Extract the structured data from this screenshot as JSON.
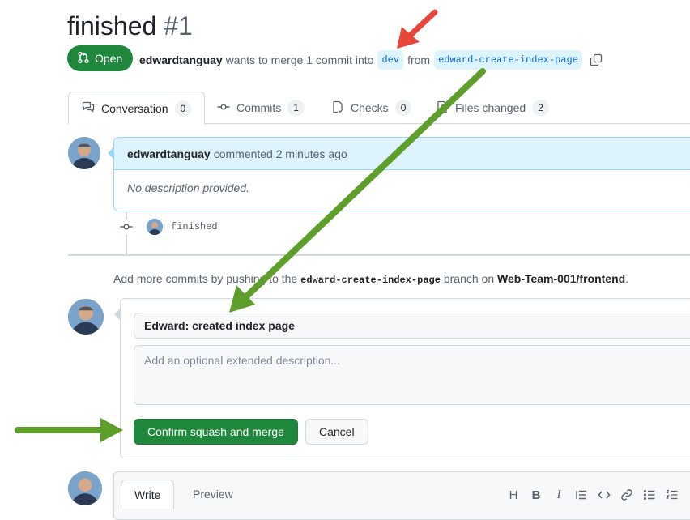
{
  "pr": {
    "title": "finished",
    "number": "#1",
    "status": "Open",
    "author": "edwardtanguay",
    "merge_text": "wants to merge 1 commit into",
    "base_branch": "dev",
    "from_text": "from",
    "head_branch": "edward-create-index-page"
  },
  "tabs": [
    {
      "label": "Conversation",
      "count": "0",
      "icon": "conversation-icon"
    },
    {
      "label": "Commits",
      "count": "1",
      "icon": "commit-icon"
    },
    {
      "label": "Checks",
      "count": "0",
      "icon": "checklist-icon"
    },
    {
      "label": "Files changed",
      "count": "2",
      "icon": "file-diff-icon"
    }
  ],
  "comment": {
    "author": "edwardtanguay",
    "action": "commented 2 minutes ago",
    "body": "No description provided."
  },
  "commit": {
    "message": "finished"
  },
  "info": {
    "prefix": "Add more commits by pushing to the",
    "branch": "edward-create-index-page",
    "middle": "branch on",
    "repo": "Web-Team-001/frontend",
    "suffix": "."
  },
  "merge_form": {
    "commit_title": "Edward: created index page",
    "description_placeholder": "Add an optional extended description...",
    "confirm_label": "Confirm squash and merge",
    "cancel_label": "Cancel"
  },
  "editor": {
    "write_label": "Write",
    "preview_label": "Preview",
    "toolbar": [
      "H",
      "B",
      "I",
      "quote-icon",
      "code-icon",
      "link-icon",
      "bulleted-list-icon",
      "numbered-list-icon"
    ]
  },
  "colors": {
    "open_green": "#1f883d",
    "branch_blue": "#0969da",
    "annotation_red": "#e8463a",
    "annotation_green": "#5e9e2b"
  }
}
